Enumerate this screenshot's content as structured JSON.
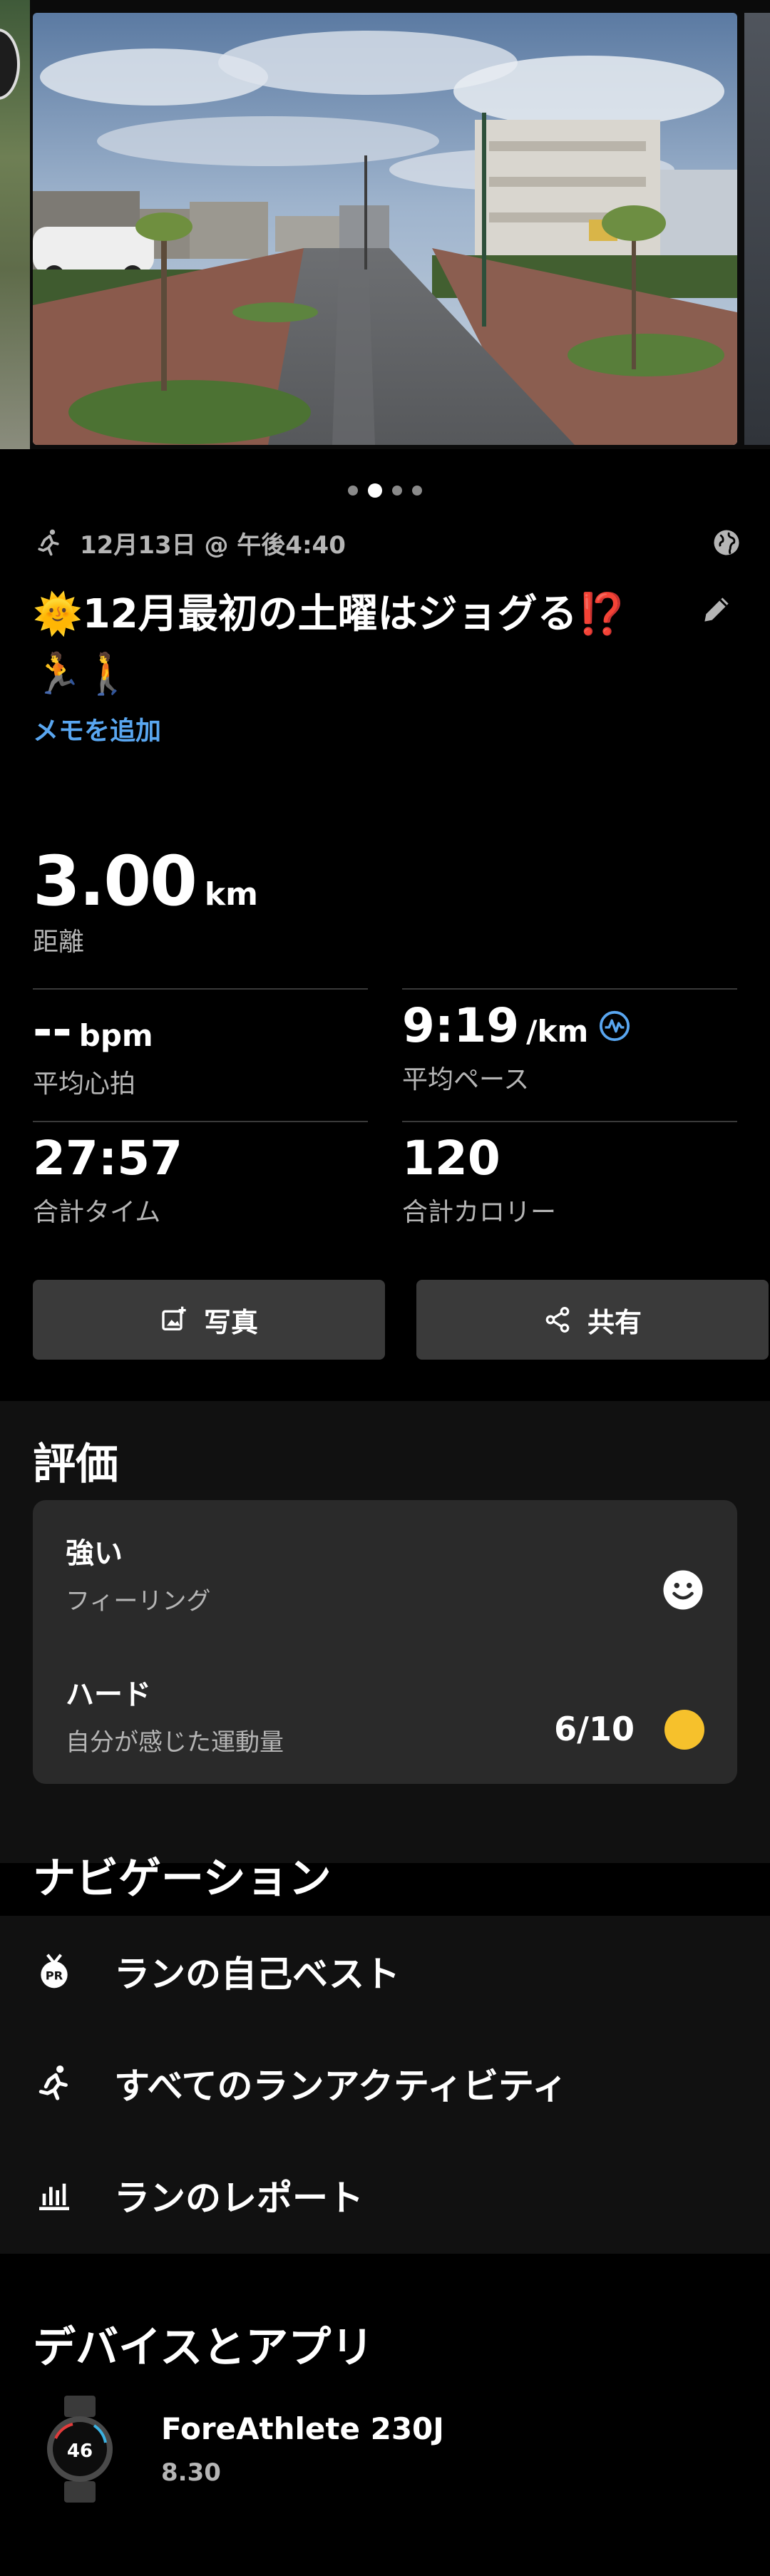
{
  "carousel": {
    "page_count": 4,
    "active_index": 1
  },
  "activity": {
    "type_icon": "running-icon",
    "datetime": "12月13日 @ 午後4:40",
    "title": "🌞12月最初の土曜はジョグる⁉️🏃🚶",
    "add_note": "メモを追加"
  },
  "stats": {
    "distance": {
      "value": "3.00",
      "unit": "km",
      "label": "距離"
    },
    "heart_rate": {
      "value": "--",
      "unit": "bpm",
      "label": "平均心拍"
    },
    "pace": {
      "value": "9:19",
      "unit": "/km",
      "label": "平均ペース"
    },
    "total_time": {
      "value": "27:57",
      "label": "合計タイム"
    },
    "calories": {
      "value": "120",
      "label": "合計カロリー"
    }
  },
  "buttons": {
    "photo": "写真",
    "share": "共有"
  },
  "evaluation": {
    "title": "評価",
    "feeling": {
      "value": "強い",
      "label": "フィーリング"
    },
    "effort": {
      "value": "ハード",
      "label": "自分が感じた運動量",
      "score": "6/10"
    }
  },
  "navigation": {
    "title": "ナビゲーション",
    "items": [
      {
        "label": "ランの自己ベスト",
        "icon": "pr-medal-icon"
      },
      {
        "label": "すべてのランアクティビティ",
        "icon": "running-icon"
      },
      {
        "label": "ランのレポート",
        "icon": "bar-chart-icon"
      }
    ]
  },
  "devices": {
    "title": "デバイスとアプリ",
    "device": {
      "name": "ForeAthlete 230J",
      "version": "8.30",
      "watch_face_number": "46"
    }
  },
  "colors": {
    "accent_link": "#59a6f0",
    "effort_dot": "#f6c12c",
    "panel": "#111111",
    "card": "#2a2a2a"
  }
}
